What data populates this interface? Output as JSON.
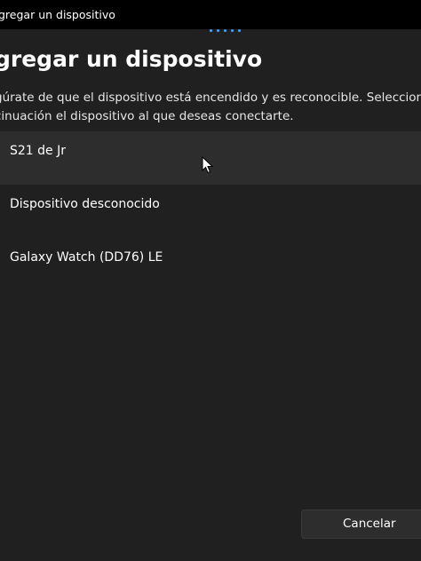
{
  "window": {
    "title": "gregar un dispositivo"
  },
  "dialog": {
    "title": "gregar un dispositivo",
    "instructions_line1": "gúrate de que el dispositivo está encendido y es reconocible. Selecciona a",
    "instructions_line2": "cinuación el dispositivo al que deseas conectarte."
  },
  "devices": [
    {
      "name": "S21 de Jr"
    },
    {
      "name": "Dispositivo desconocido"
    },
    {
      "name": "Galaxy Watch (DD76) LE"
    }
  ],
  "footer": {
    "cancel_label": "Cancelar"
  },
  "icons": {
    "cursor": "mouse-pointer-icon"
  },
  "colors": {
    "accent": "#4aa3ff",
    "background": "#202020",
    "hover": "#2d2d2d"
  }
}
